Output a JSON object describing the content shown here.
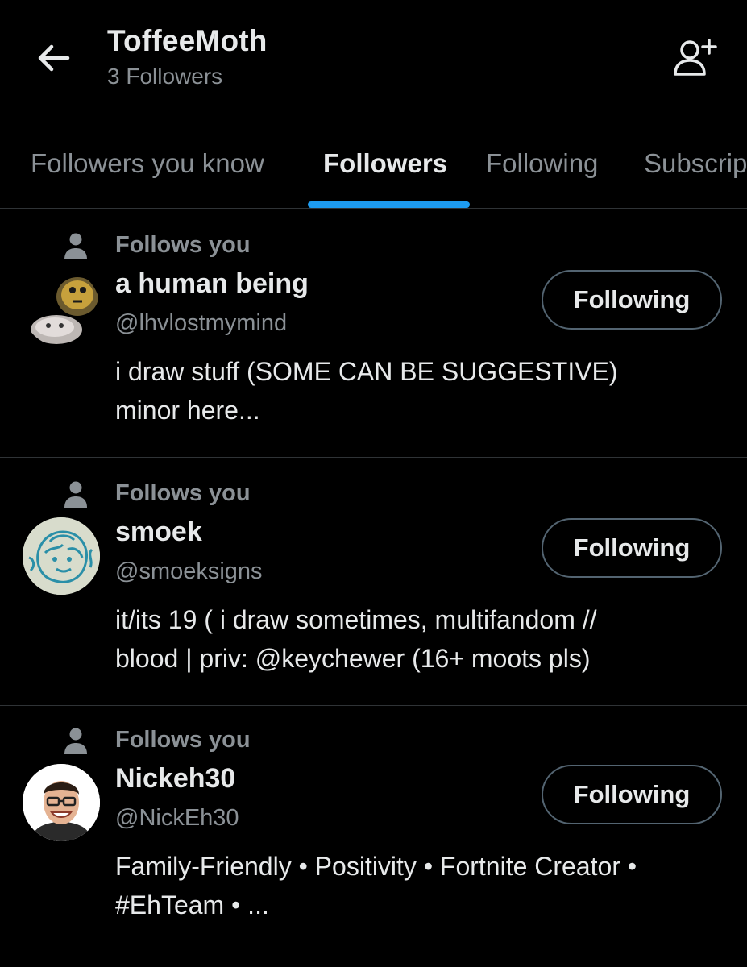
{
  "header": {
    "title": "ToffeeMoth",
    "subtitle": "3 Followers",
    "back_icon": "arrow-left-icon",
    "add_user_icon": "person-plus-icon"
  },
  "tabs": [
    {
      "label": "Followers you know",
      "active": false
    },
    {
      "label": "Followers",
      "active": true
    },
    {
      "label": "Following",
      "active": false
    },
    {
      "label": "Subscriptions",
      "active": false
    }
  ],
  "accent_color": "#1d9bf0",
  "followers": [
    {
      "follows_you": "Follows you",
      "name": "a human being",
      "handle": "@lhvlostmymind",
      "button": "Following",
      "bio_lines": [
        "i draw stuff (SOME CAN BE SUGGESTIVE)",
        "minor here..."
      ]
    },
    {
      "follows_you": "Follows you",
      "name": "smoek",
      "handle": "@smoeksigns",
      "button": "Following",
      "bio_lines": [
        "it/its 19 ( i draw sometimes, multifandom //",
        "blood | priv: @keychewer (16+ moots pls)"
      ]
    },
    {
      "follows_you": "Follows you",
      "name": "Nickeh30",
      "handle": "@NickEh30",
      "button": "Following",
      "bio_lines": [
        "Family-Friendly • Positivity • Fortnite Creator •",
        "#EhTeam • ..."
      ]
    }
  ]
}
